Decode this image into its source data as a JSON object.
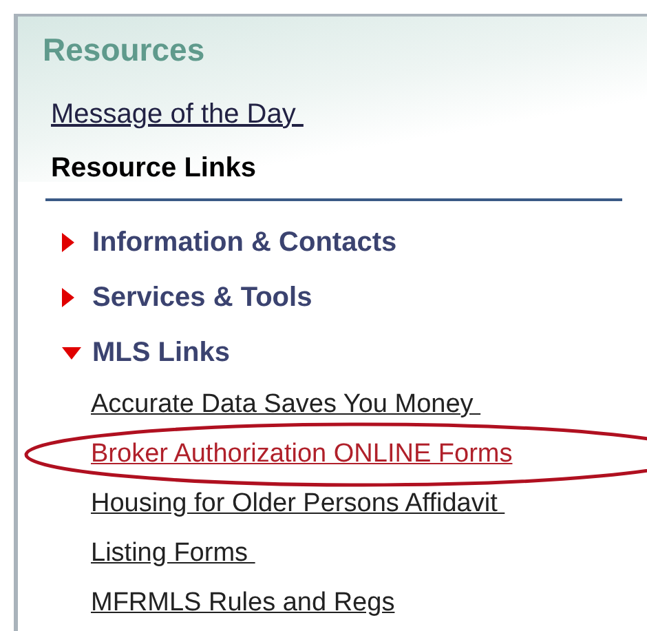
{
  "panel": {
    "title": "Resources",
    "top_link": "Message of the Day ",
    "section_heading": "Resource Links",
    "categories": [
      {
        "label": "Information & Contacts",
        "expanded": false
      },
      {
        "label": "Services & Tools",
        "expanded": false
      },
      {
        "label": "MLS Links",
        "expanded": true,
        "children": [
          {
            "label": "Accurate Data Saves You Money ",
            "highlighted": false
          },
          {
            "label": "Broker Authorization ONLINE Forms",
            "highlighted": true
          },
          {
            "label": "Housing for Older Persons Affidavit ",
            "highlighted": false
          },
          {
            "label": "Listing Forms ",
            "highlighted": false
          },
          {
            "label": "MFRMLS Rules and Regs",
            "highlighted": false
          }
        ]
      }
    ]
  }
}
